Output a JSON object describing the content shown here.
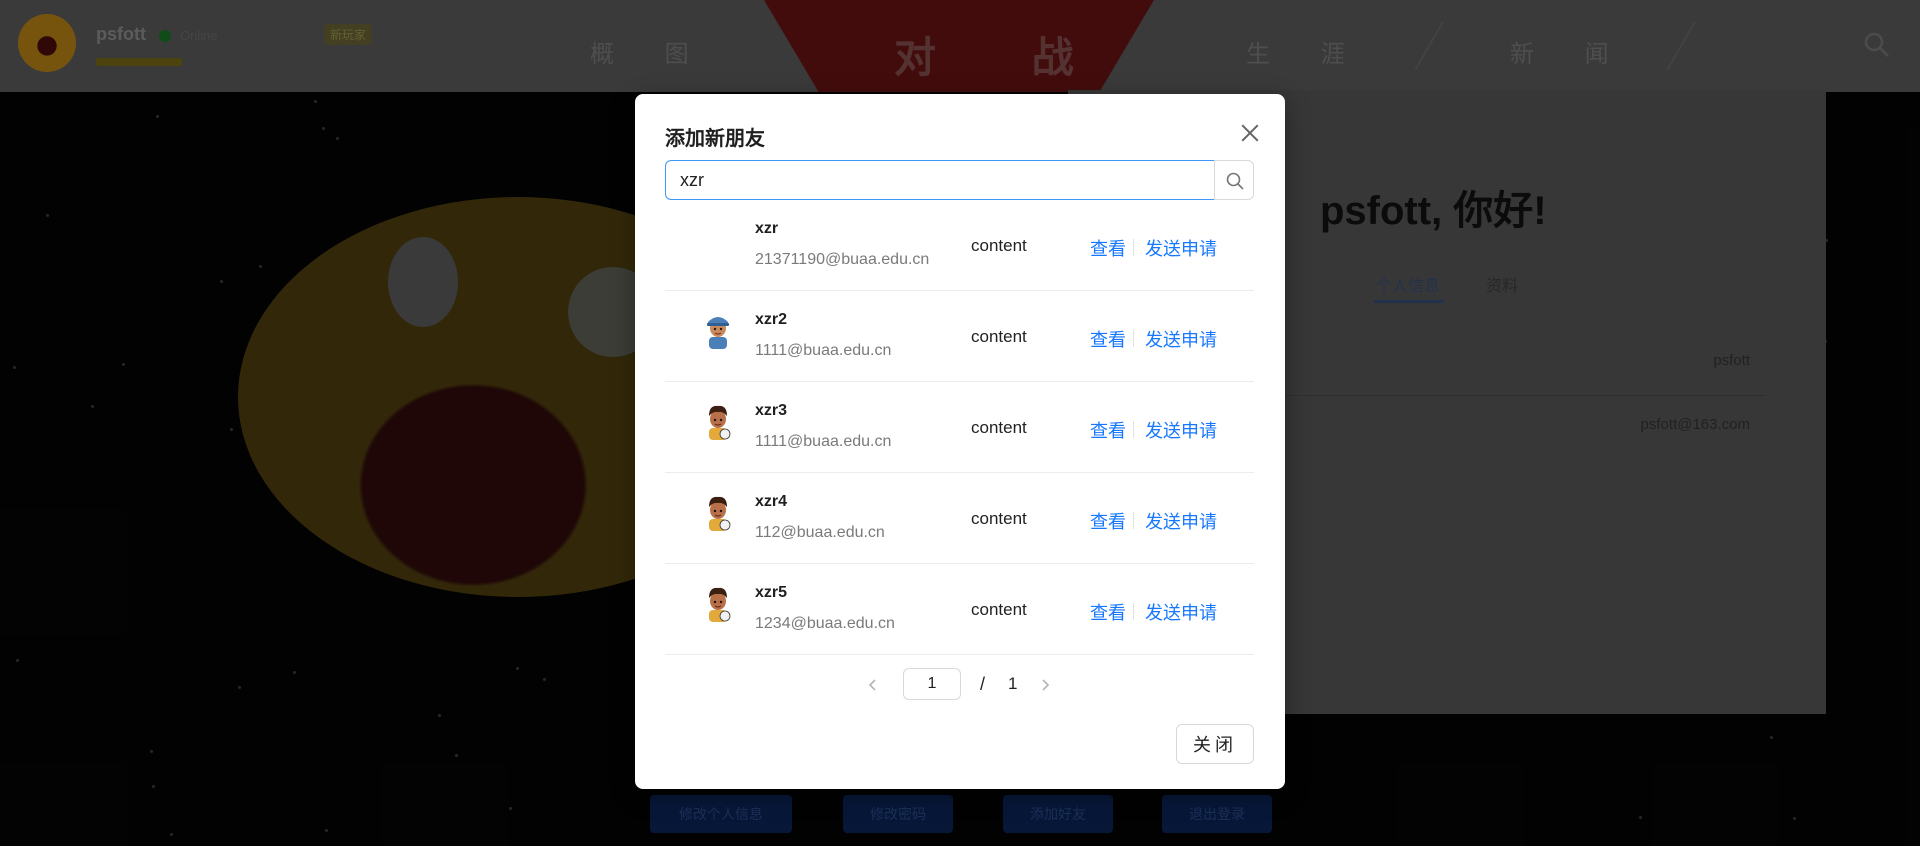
{
  "background": {
    "topbar": {
      "username": "psfott",
      "online_status": "Online",
      "badge": "新玩家",
      "nav_left": "概 图",
      "nav_main": "对 战",
      "nav_mid": "生 涯",
      "nav_right": "新 闻"
    },
    "profile": {
      "greeting": "psfott, 你好!",
      "tab_active": "个人信息",
      "tab_other": "资料",
      "row_username": "psfott",
      "row_email": "psfott@163.com"
    },
    "bottom_buttons": [
      "修改个人信息",
      "修改密码",
      "添加好友",
      "退出登录"
    ]
  },
  "modal": {
    "title": "添加新朋友",
    "search": {
      "value": "xzr",
      "placeholder": ""
    },
    "results": [
      {
        "name": "xzr",
        "email": "21371190@buaa.edu.cn",
        "content": "content",
        "view_label": "查看",
        "send_label": "发送申请",
        "avatar": "none"
      },
      {
        "name": "xzr2",
        "email": "1111@buaa.edu.cn",
        "content": "content",
        "view_label": "查看",
        "send_label": "发送申请",
        "avatar": "cap-boy-avatar"
      },
      {
        "name": "xzr3",
        "email": "1111@buaa.edu.cn",
        "content": "content",
        "view_label": "查看",
        "send_label": "发送申请",
        "avatar": "curly-boy-avatar"
      },
      {
        "name": "xzr4",
        "email": "112@buaa.edu.cn",
        "content": "content",
        "view_label": "查看",
        "send_label": "发送申请",
        "avatar": "curly-boy-avatar"
      },
      {
        "name": "xzr5",
        "email": "1234@buaa.edu.cn",
        "content": "content",
        "view_label": "查看",
        "send_label": "发送申请",
        "avatar": "curly-boy-avatar"
      }
    ],
    "pagination": {
      "current": "1",
      "separator": "/",
      "total": "1"
    },
    "close_label": "关闭"
  },
  "colors": {
    "link": "#1677ff",
    "input_focus": "#4096ff",
    "mask": "rgba(0,0,0,0.45)"
  }
}
